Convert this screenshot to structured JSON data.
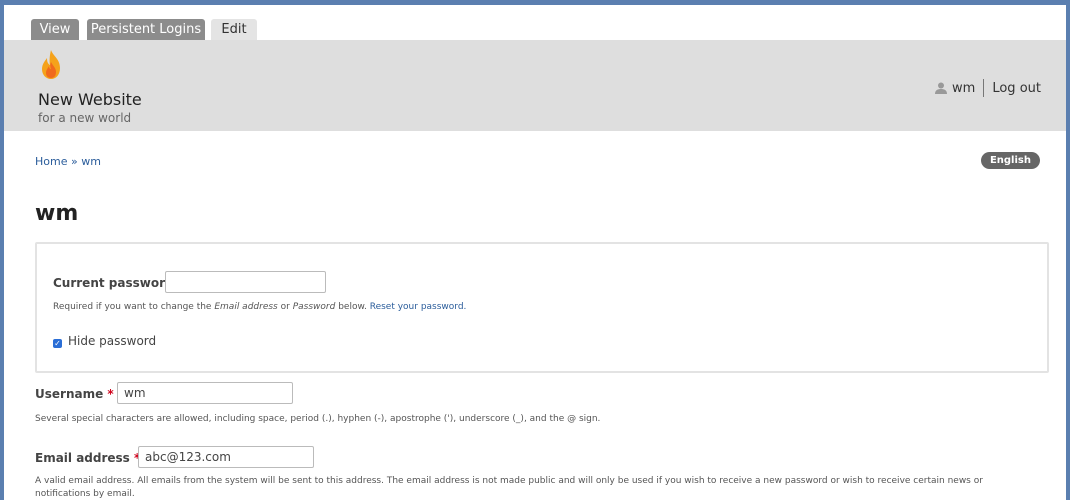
{
  "tabs": [
    {
      "label": "View"
    },
    {
      "label": "Persistent Logins"
    },
    {
      "label": "Edit"
    }
  ],
  "site": {
    "name": "New Website",
    "slogan": "for a new world"
  },
  "user_menu": {
    "username": "wm",
    "logout": "Log out"
  },
  "breadcrumb": {
    "home": "Home",
    "separator": "»",
    "current": "wm"
  },
  "language": "English",
  "page_title": "wm",
  "current_password": {
    "label": "Current password",
    "value": "",
    "desc_prefix": "Required if you want to change the",
    "desc_email": "Email address",
    "desc_or": "or",
    "desc_password": "Password",
    "desc_below": "below.",
    "reset_link": "Reset your password."
  },
  "hide_password": {
    "label": "Hide password",
    "checked": true
  },
  "username": {
    "label": "Username",
    "required_mark": "*",
    "value": "wm",
    "description": "Several special characters are allowed, including space, period (.), hyphen (-), apostrophe ('), underscore (_), and the @ sign."
  },
  "email": {
    "label": "Email address",
    "required_mark": "*",
    "value": "abc@123.com",
    "description": "A valid email address. All emails from the system will be sent to this address. The email address is not made public and will only be used if you wish to receive a new password or wish to receive certain news or notifications by email."
  },
  "colors": {
    "frame": "#5b7fb0",
    "header_bg": "#dedede",
    "link": "#2b5d9b",
    "required": "#d0021b",
    "checkbox": "#2a6ed6"
  }
}
